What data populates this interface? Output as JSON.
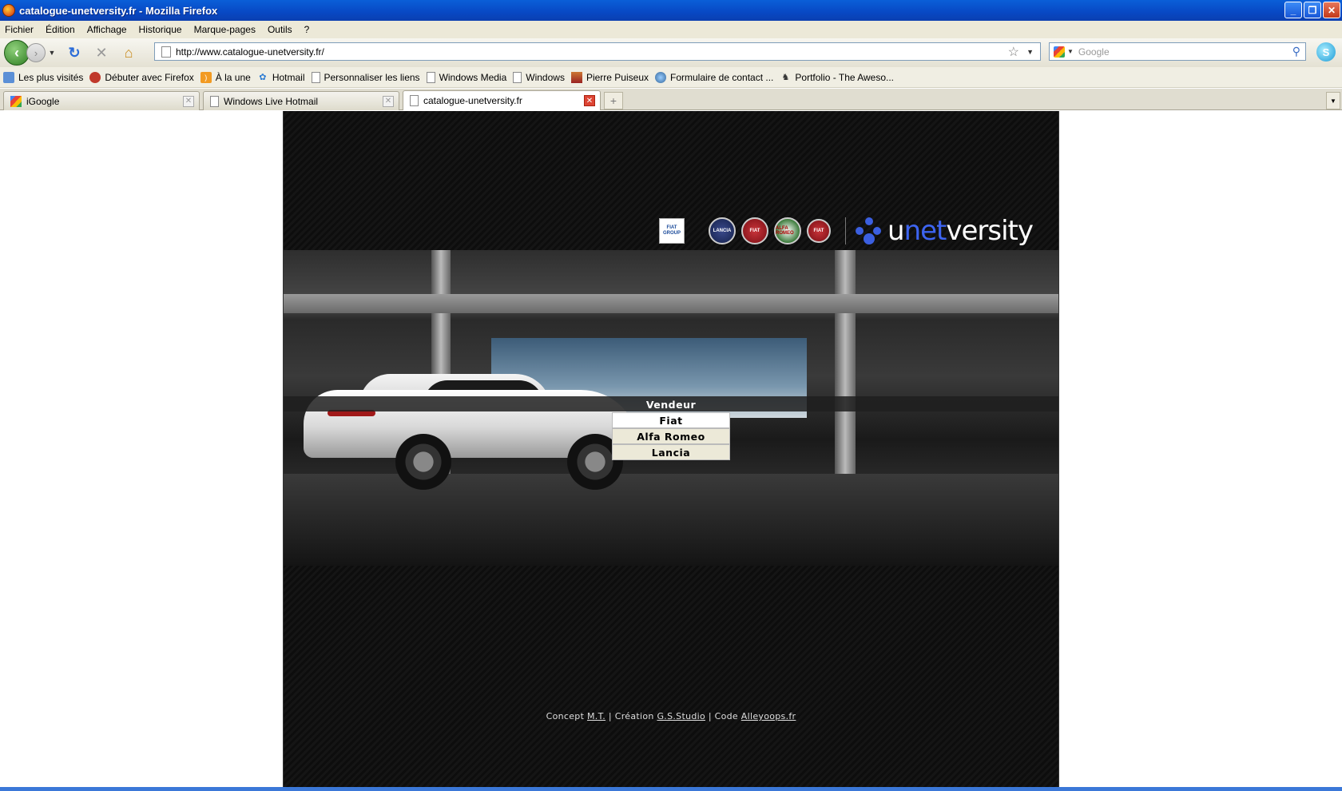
{
  "window": {
    "title": "catalogue-unetversity.fr - Mozilla Firefox"
  },
  "menubar": [
    "Fichier",
    "Édition",
    "Affichage",
    "Historique",
    "Marque-pages",
    "Outils",
    "?"
  ],
  "navbar": {
    "url": "http://www.catalogue-unetversity.fr/",
    "search_placeholder": "Google"
  },
  "bookmarks": [
    {
      "label": "Les plus visités",
      "icon": "folder-icon"
    },
    {
      "label": "Débuter avec Firefox",
      "icon": "firefox-icon"
    },
    {
      "label": "À la une",
      "icon": "rss-icon"
    },
    {
      "label": "Hotmail",
      "icon": "msn-icon"
    },
    {
      "label": "Personnaliser les liens",
      "icon": "page-icon"
    },
    {
      "label": "Windows Media",
      "icon": "page-icon"
    },
    {
      "label": "Windows",
      "icon": "page-icon"
    },
    {
      "label": "Pierre Puiseux",
      "icon": "flag-icon"
    },
    {
      "label": "Formulaire de contact ...",
      "icon": "globe-icon"
    },
    {
      "label": "Portfolio - The Aweso...",
      "icon": "bat-icon"
    }
  ],
  "tabs": [
    {
      "label": "iGoogle"
    },
    {
      "label": "Windows Live Hotmail"
    },
    {
      "label": "catalogue-unetversity.fr"
    }
  ],
  "site": {
    "logos": {
      "fiat_group": "FIAT GROUP",
      "lancia": "LANCIA",
      "fiat": "FIAT",
      "alfa": "ALFA ROMEO",
      "professional": "FIAT",
      "brand_u": "u",
      "brand_net": "net",
      "brand_versity": "versity"
    },
    "menu": {
      "header": "Vendeur",
      "items": [
        "Fiat",
        "Alfa Romeo",
        "Lancia"
      ]
    },
    "footer": {
      "concept_label": "Concept",
      "concept_link": "M.T.",
      "sep1": "|",
      "creation_label": "Création",
      "creation_link": "G.S.Studio",
      "sep2": "|",
      "code_label": "Code",
      "code_link": "Alleyoops.fr"
    }
  }
}
